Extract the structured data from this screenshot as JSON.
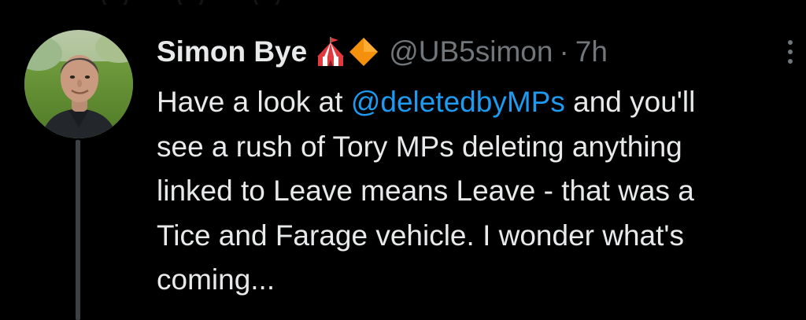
{
  "colors": {
    "background": "#000000",
    "text_primary": "#e7e9ea",
    "text_secondary": "#71767b",
    "link": "#1d9bf0",
    "thread_line": "#3e4144"
  },
  "tweet": {
    "author": {
      "display_name": "Simon Bye",
      "badges": [
        "circus-tent-emoji",
        "orange-diamond-emoji"
      ],
      "handle": "@UB5simon",
      "avatar": "avatar-photo"
    },
    "separator": "·",
    "time_ago": "7h",
    "more_icon": "more-vertical-icon",
    "text": {
      "line1_before": "Have a look at ",
      "mention": "@deletedbyMPs",
      "line1_after": " and you'll",
      "line2": "see a rush of Tory MPs deleting anything",
      "line3": "linked to Leave means Leave - that was a",
      "line4": "Tice and Farage vehicle. I wonder what's",
      "line5": "coming..."
    }
  }
}
